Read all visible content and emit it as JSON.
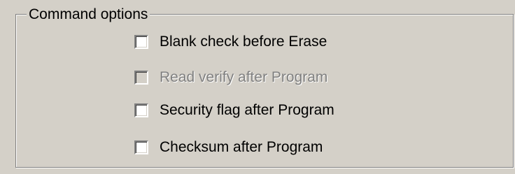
{
  "group": {
    "title": "Command options"
  },
  "options": [
    {
      "label": "Blank check before Erase",
      "checked": false,
      "enabled": true
    },
    {
      "label": "Read verify after Program",
      "checked": false,
      "enabled": false
    },
    {
      "label": "Security flag after Program",
      "checked": false,
      "enabled": true
    },
    {
      "label": "Checksum after Program",
      "checked": false,
      "enabled": true
    }
  ],
  "colors": {
    "face": "#d4d0c8",
    "shadow": "#808080",
    "highlight": "#ffffff",
    "text": "#000000",
    "disabled_text": "#808080"
  }
}
